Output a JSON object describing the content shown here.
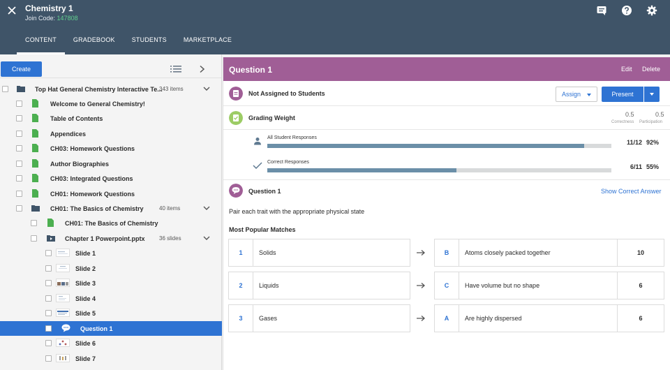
{
  "header": {
    "course_title": "Chemistry 1",
    "join_label": "Join Code:",
    "join_code": "147808",
    "tabs": [
      {
        "label": "CONTENT"
      },
      {
        "label": "GRADEBOOK"
      },
      {
        "label": "STUDENTS"
      },
      {
        "label": "MARKETPLACE"
      }
    ]
  },
  "sidebar": {
    "create_label": "Create",
    "items": [
      {
        "label": "Top Hat General Chemistry Interactive Te...",
        "count": "343 items",
        "type": "folder"
      },
      {
        "label": "Welcome to General Chemistry!",
        "type": "page"
      },
      {
        "label": "Table of Contents",
        "type": "page"
      },
      {
        "label": "Appendices",
        "type": "page"
      },
      {
        "label": "CH03: Homework Questions",
        "type": "page"
      },
      {
        "label": "Author Biographies",
        "type": "page"
      },
      {
        "label": "CH03: Integrated Questions",
        "type": "page"
      },
      {
        "label": "CH01: Homework Questions",
        "type": "page"
      },
      {
        "label": "CH01: The Basics of Chemistry",
        "count": "40 items",
        "type": "folder"
      },
      {
        "label": "CH01: The Basics of Chemistry",
        "type": "page"
      },
      {
        "label": "Chapter 1 Powerpoint.pptx",
        "count": "36 slides",
        "type": "presentation"
      },
      {
        "label": "Slide 1",
        "type": "slide"
      },
      {
        "label": "Slide 2",
        "type": "slide"
      },
      {
        "label": "Slide 3",
        "type": "slide"
      },
      {
        "label": "Slide 4",
        "type": "slide"
      },
      {
        "label": "Slide 5",
        "type": "slide"
      },
      {
        "label": "Question 1",
        "type": "question"
      },
      {
        "label": "Slide 6",
        "type": "slide"
      },
      {
        "label": "Slide 7",
        "type": "slide"
      }
    ]
  },
  "question": {
    "title": "Question 1",
    "edit_label": "Edit",
    "delete_label": "Delete",
    "assign_status": "Not Assigned to Students",
    "assign_label": "Assign",
    "present_label": "Present",
    "grading_label": "Grading Weight",
    "correctness_value": "0.5",
    "correctness_caption": "Correctness",
    "participation_value": "0.5",
    "participation_caption": "Participation",
    "responses": [
      {
        "label": "All Student Responses",
        "stat": "11/12",
        "percent": "92%",
        "fraction": 0.92
      },
      {
        "label": "Correct Responses",
        "stat": "6/11",
        "percent": "55%",
        "fraction": 0.55
      }
    ],
    "section_title": "Question 1",
    "show_answer_label": "Show Correct Answer",
    "prompt": "Pair each trait with the appropriate physical state",
    "matches_title": "Most Popular Matches",
    "matches": [
      {
        "num": "1",
        "left": "Solids",
        "letter": "B",
        "right": "Atoms closely packed together",
        "count": "10"
      },
      {
        "num": "2",
        "left": "Liquids",
        "letter": "C",
        "right": "Have volume but no shape",
        "count": "6"
      },
      {
        "num": "3",
        "left": "Gases",
        "letter": "A",
        "right": "Are highly dispersed",
        "count": "6"
      }
    ]
  },
  "colors": {
    "header_bg": "#3f5468",
    "accent_blue": "#2e73d3",
    "question_purple": "#a05e96",
    "join_code_green": "#62d08f",
    "doc_green": "#4caf50"
  }
}
